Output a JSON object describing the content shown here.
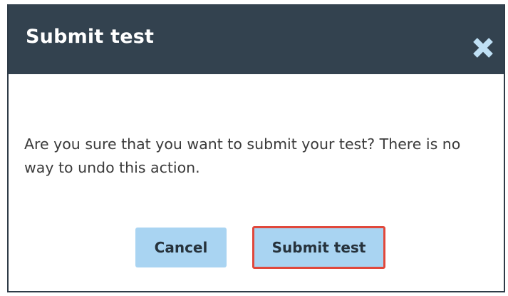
{
  "dialog": {
    "title": "Submit test",
    "close_icon": "close-icon",
    "message": "Are you sure that you want to submit your test? There is no way to undo this action.",
    "buttons": {
      "cancel_label": "Cancel",
      "submit_label": "Submit test"
    }
  },
  "colors": {
    "header_bg": "#33424f",
    "button_bg": "#a9d4f2",
    "close_icon": "#bfe0f5",
    "highlight_border": "#e0483c"
  }
}
